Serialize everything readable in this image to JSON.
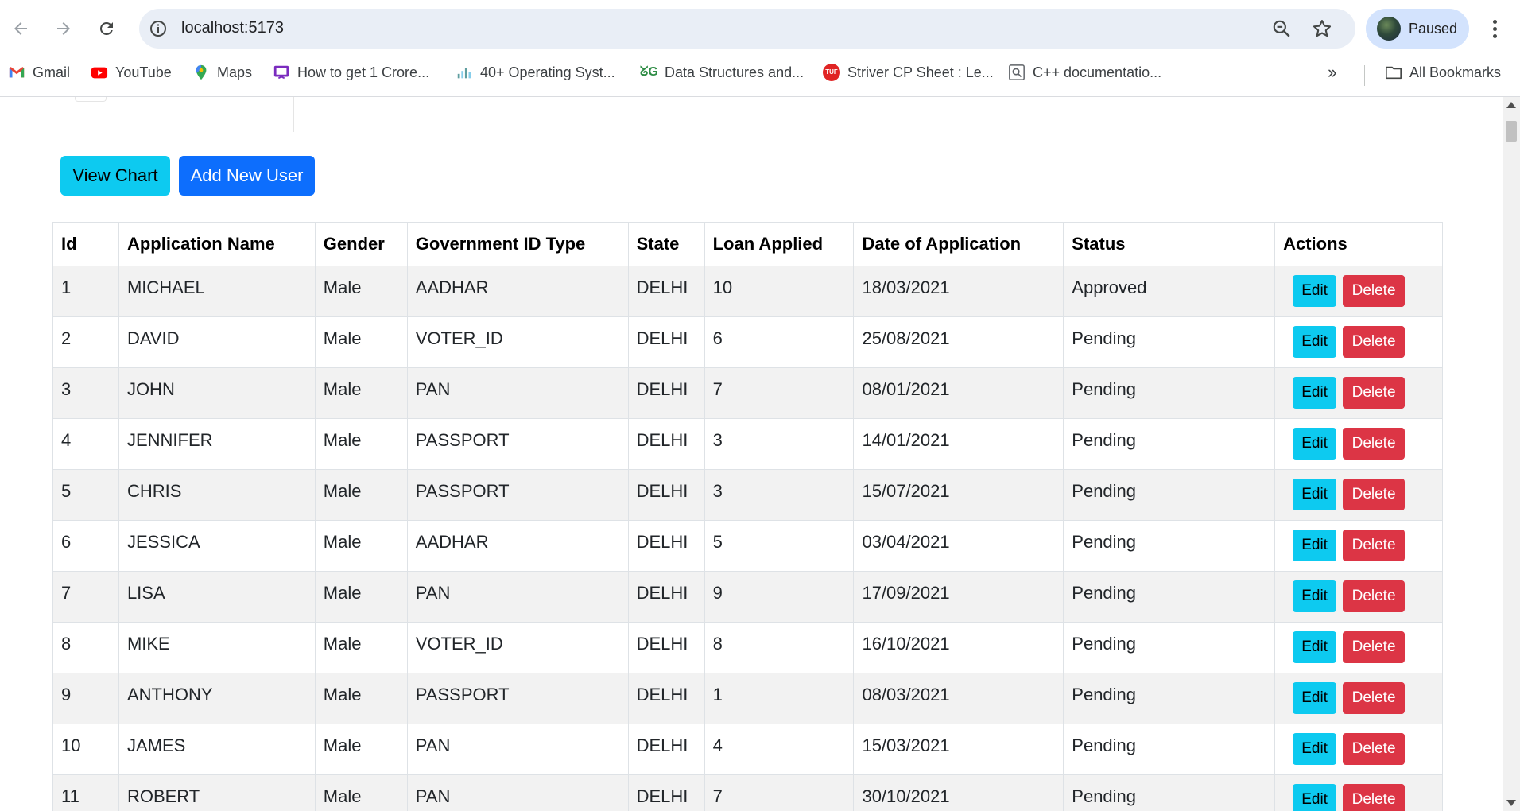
{
  "browser": {
    "url": "localhost:5173",
    "profile_status": "Paused",
    "bookmarks": [
      {
        "label": "Gmail",
        "icon": "gmail-icon"
      },
      {
        "label": "YouTube",
        "icon": "youtube-icon"
      },
      {
        "label": "Maps",
        "icon": "maps-icon"
      },
      {
        "label": "How to get 1 Crore...",
        "icon": "course-icon"
      },
      {
        "label": "40+ Operating Syst...",
        "icon": "chart-icon"
      },
      {
        "label": "Data Structures and...",
        "icon": "geeksforgeeks-icon"
      },
      {
        "label": "Striver CP Sheet : Le...",
        "icon": "tuf-icon"
      },
      {
        "label": "C++ documentatio...",
        "icon": "search-page-icon"
      }
    ],
    "all_bookmarks_label": "All Bookmarks"
  },
  "actions": {
    "view_chart_label": "View Chart",
    "add_user_label": "Add New User"
  },
  "table": {
    "headers": [
      "Id",
      "Application Name",
      "Gender",
      "Government ID Type",
      "State",
      "Loan Applied",
      "Date of Application",
      "Status",
      "Actions"
    ],
    "edit_label": "Edit",
    "delete_label": "Delete",
    "rows": [
      {
        "id": "1",
        "name": "MICHAEL",
        "gender": "Male",
        "gov_id": "AADHAR",
        "state": "DELHI",
        "loan": "10",
        "date": "18/03/2021",
        "status": "Approved"
      },
      {
        "id": "2",
        "name": "DAVID",
        "gender": "Male",
        "gov_id": "VOTER_ID",
        "state": "DELHI",
        "loan": "6",
        "date": "25/08/2021",
        "status": "Pending"
      },
      {
        "id": "3",
        "name": "JOHN",
        "gender": "Male",
        "gov_id": "PAN",
        "state": "DELHI",
        "loan": "7",
        "date": "08/01/2021",
        "status": "Pending"
      },
      {
        "id": "4",
        "name": "JENNIFER",
        "gender": "Male",
        "gov_id": "PASSPORT",
        "state": "DELHI",
        "loan": "3",
        "date": "14/01/2021",
        "status": "Pending"
      },
      {
        "id": "5",
        "name": "CHRIS",
        "gender": "Male",
        "gov_id": "PASSPORT",
        "state": "DELHI",
        "loan": "3",
        "date": "15/07/2021",
        "status": "Pending"
      },
      {
        "id": "6",
        "name": "JESSICA",
        "gender": "Male",
        "gov_id": "AADHAR",
        "state": "DELHI",
        "loan": "5",
        "date": "03/04/2021",
        "status": "Pending"
      },
      {
        "id": "7",
        "name": "LISA",
        "gender": "Male",
        "gov_id": "PAN",
        "state": "DELHI",
        "loan": "9",
        "date": "17/09/2021",
        "status": "Pending"
      },
      {
        "id": "8",
        "name": "MIKE",
        "gender": "Male",
        "gov_id": "VOTER_ID",
        "state": "DELHI",
        "loan": "8",
        "date": "16/10/2021",
        "status": "Pending"
      },
      {
        "id": "9",
        "name": "ANTHONY",
        "gender": "Male",
        "gov_id": "PASSPORT",
        "state": "DELHI",
        "loan": "1",
        "date": "08/03/2021",
        "status": "Pending"
      },
      {
        "id": "10",
        "name": "JAMES",
        "gender": "Male",
        "gov_id": "PAN",
        "state": "DELHI",
        "loan": "4",
        "date": "15/03/2021",
        "status": "Pending"
      },
      {
        "id": "11",
        "name": "ROBERT",
        "gender": "Male",
        "gov_id": "PAN",
        "state": "DELHI",
        "loan": "7",
        "date": "30/10/2021",
        "status": "Pending"
      }
    ]
  },
  "colors": {
    "info_button": "#0dcaf0",
    "primary_button": "#0d6efd",
    "danger_button": "#dc3545",
    "striped_row": "#f2f2f2"
  }
}
